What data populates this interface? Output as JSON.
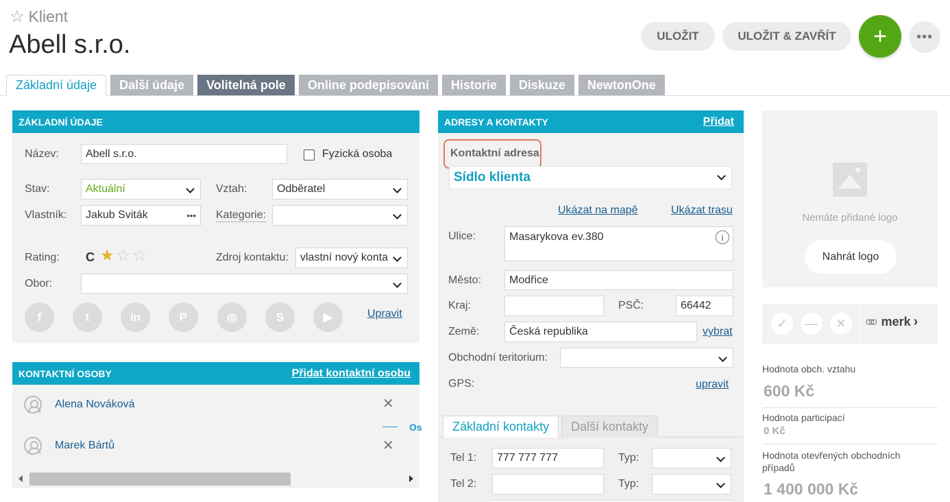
{
  "header": {
    "entity_type": "Klient",
    "title": "Abell s.r.o.",
    "save_label": "ULOŽIT",
    "save_close_label": "ULOŽIT & ZAVŘÍT",
    "add_glyph": "+",
    "more_glyph": "•••"
  },
  "tabs": [
    {
      "label": "Základní údaje",
      "state": "active"
    },
    {
      "label": "Další údaje",
      "state": "inactive"
    },
    {
      "label": "Volitelná pole",
      "state": "highlighted"
    },
    {
      "label": "Online podepisování",
      "state": "inactive"
    },
    {
      "label": "Historie",
      "state": "inactive"
    },
    {
      "label": "Diskuze",
      "state": "inactive"
    },
    {
      "label": "NewtonOne",
      "state": "inactive"
    }
  ],
  "basic": {
    "header": "ZÁKLADNÍ ÚDAJE",
    "name_label": "Název:",
    "name_value": "Abell s.r.o.",
    "natural_person_label": "Fyzická osoba",
    "status_label": "Stav:",
    "status_value": "Aktuální",
    "relation_label": "Vztah:",
    "relation_value": "Odběratel",
    "owner_label": "Vlastník:",
    "owner_value": "Jakub Sviták",
    "owner_more": "•••",
    "category_label": "Kategorie:",
    "category_value": "",
    "rating_label": "Rating:",
    "rating_grade": "C",
    "rating_stars_filled": 1,
    "rating_stars_total": 3,
    "source_label": "Zdroj kontaktu:",
    "source_value": "vlastní nový konta",
    "field_label": "Obor:",
    "field_value": "",
    "social_icons": [
      "facebook-icon",
      "twitter-icon",
      "linkedin-icon",
      "pinterest-icon",
      "instagram-icon",
      "skype-icon",
      "youtube-icon"
    ],
    "social_glyphs": [
      "f",
      "t",
      "in",
      "P",
      "◎",
      "S",
      "▶"
    ],
    "edit_link": "Upravit"
  },
  "contacts": {
    "header": "KONTAKTNÍ OSOBY",
    "add_link": "Přidat kontaktní osobu",
    "people": [
      "Alena Nováková",
      "Marek Bártů"
    ],
    "remove_glyph": "✕",
    "side_fragment": "Os"
  },
  "address": {
    "header": "ADRESY A KONTAKTY",
    "add_link": "Přidat",
    "contact_address_label": "Kontaktní adresa",
    "address_type": "Sídlo klienta",
    "map_link": "Ukázat na mapě",
    "route_link": "Ukázat trasu",
    "street_label": "Ulice:",
    "street_value": "Masarykova ev.380",
    "info_glyph": "i",
    "city_label": "Město:",
    "city_value": "Modřice",
    "region_label": "Kraj:",
    "region_value": "",
    "zip_label": "PSČ:",
    "zip_value": "66442",
    "country_label": "Země:",
    "country_value": "Česká republika",
    "choose_link": "vybrat",
    "territory_label": "Obchodní teritorium:",
    "territory_value": "",
    "gps_label": "GPS:",
    "gps_edit_link": "upravit",
    "subtabs": [
      "Základní kontakty",
      "Další kontakty"
    ],
    "tel1_label": "Tel 1:",
    "tel1_value": "777 777 777",
    "tel2_label": "Tel 2:",
    "tel2_value": "",
    "type_label": "Typ:"
  },
  "logo": {
    "empty_text": "Nemáte přidané logo",
    "upload_label": "Nahrát logo"
  },
  "merk": {
    "check_glyph": "✓",
    "minus_glyph": "—",
    "cross_glyph": "✕",
    "brand": "merk",
    "chevron": "›"
  },
  "values": {
    "relation_value_label": "Hodnota obch. vztahu",
    "relation_value": "600 Kč",
    "participation_label": "Hodnota participací",
    "participation_value": "0 Kč",
    "open_cases_label": "Hodnota otevřených obchodních případů",
    "open_cases_value": "1 400 000 Kč"
  },
  "colors": {
    "accent": "#0fa7c7",
    "add_button": "#55a614",
    "highlight_border": "#e0795b",
    "status_green": "#62a91e",
    "star_filled": "#e6b325"
  }
}
